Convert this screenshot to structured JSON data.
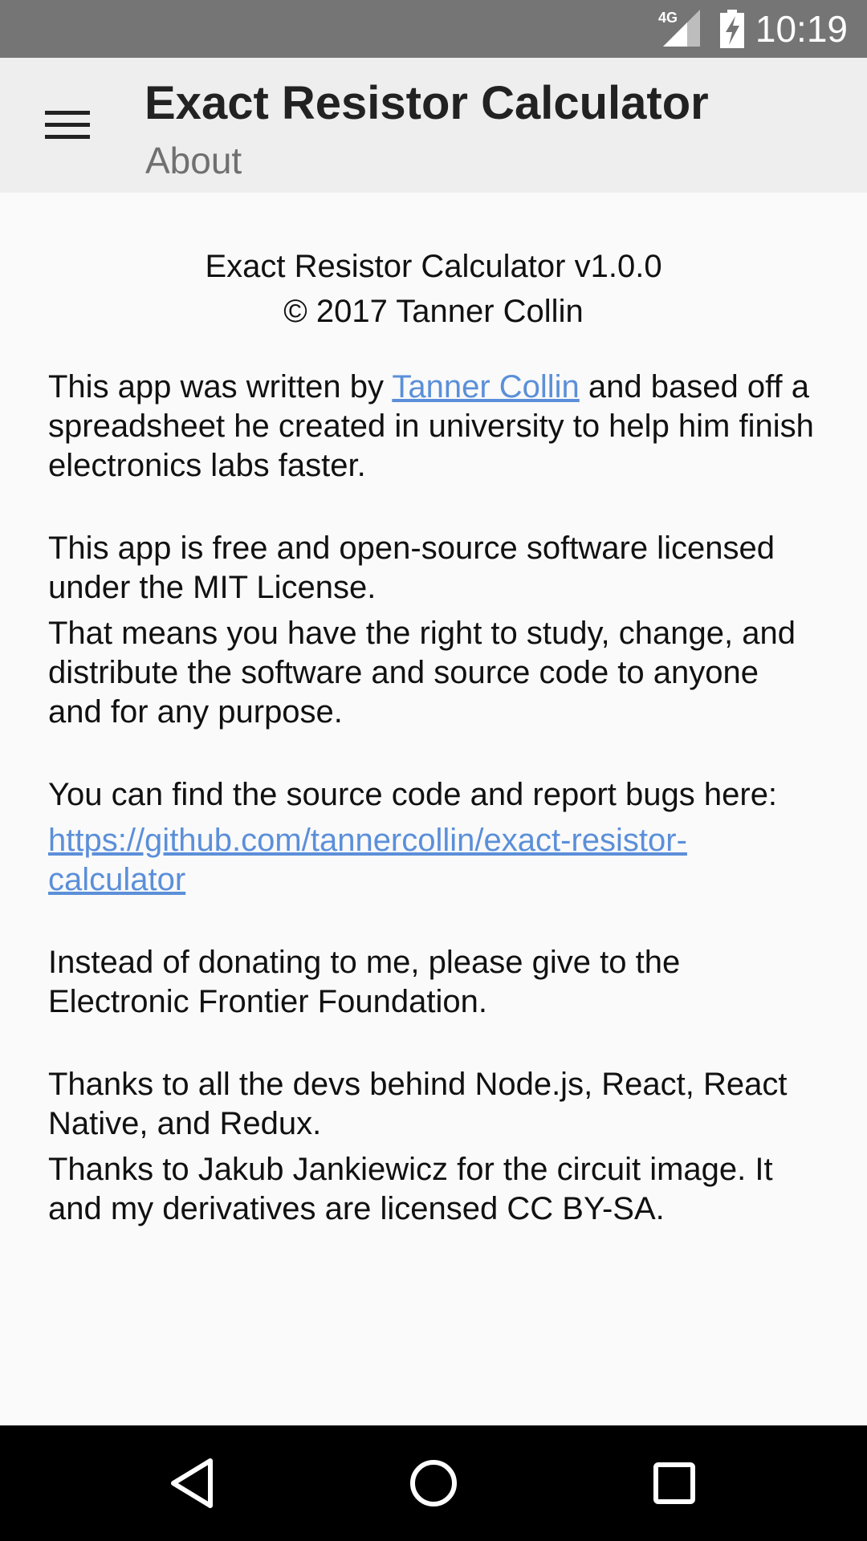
{
  "status_bar": {
    "network": "4G",
    "time": "10:19"
  },
  "app_bar": {
    "title": "Exact Resistor Calculator",
    "subtitle": "About"
  },
  "about": {
    "version_line": "Exact Resistor Calculator v1.0.0",
    "copyright_line": "© 2017 Tanner Collin",
    "p1_before": "This app was written by ",
    "p1_link": "Tanner Collin",
    "p1_after": " and based off a spreadsheet he created in university to help him finish electronics labs faster.",
    "p2": "This app is free and open-source software licensed under the MIT License.",
    "p3": "That means you have the right to study, change, and distribute the software and source code to anyone and for any purpose.",
    "p4": "You can find the source code and report bugs here:",
    "repo_link": "https://github.com/tannercollin/exact-resistor-calculator",
    "p5": "Instead of donating to me, please give to the Electronic Frontier Foundation.",
    "p6": "Thanks to all the devs behind Node.js, React, React Native, and Redux.",
    "p7": "Thanks to Jakub Jankiewicz for the circuit image. It and my derivatives are licensed CC BY-SA."
  },
  "colors": {
    "status_bar": "#757575",
    "app_bar": "#eeeeee",
    "background": "#fafafa",
    "link": "#5b8fd9",
    "nav_bar": "#000000"
  },
  "icons": {
    "menu": "hamburger-menu-icon",
    "signal": "cell-signal-icon",
    "battery": "battery-charging-icon",
    "back": "nav-back-icon",
    "home": "nav-home-icon",
    "recents": "nav-recents-icon"
  }
}
